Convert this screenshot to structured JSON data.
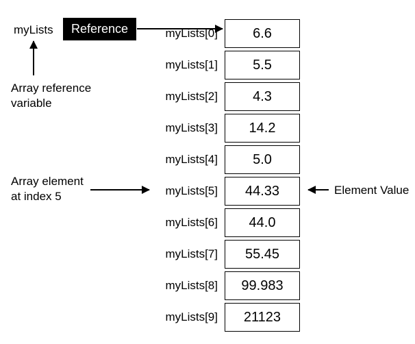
{
  "variable_name": "myLists",
  "reference_label": "Reference",
  "captions": {
    "array_ref_var": "Array reference\nvariable",
    "array_elem_at": "Array element\nat index 5",
    "element_value": "Element Value"
  },
  "rows": [
    {
      "label": "myLists[0]",
      "value": "6.6"
    },
    {
      "label": "myLists[1]",
      "value": "5.5"
    },
    {
      "label": "myLists[2]",
      "value": "4.3"
    },
    {
      "label": "myLists[3]",
      "value": "14.2"
    },
    {
      "label": "myLists[4]",
      "value": "5.0"
    },
    {
      "label": "myLists[5]",
      "value": "44.33"
    },
    {
      "label": "myLists[6]",
      "value": "44.0"
    },
    {
      "label": "myLists[7]",
      "value": "55.45"
    },
    {
      "label": "myLists[8]",
      "value": "99.983"
    },
    {
      "label": "myLists[9]",
      "value": "21123"
    }
  ],
  "chart_data": {
    "type": "table",
    "title": "Array reference diagram",
    "categories": [
      "myLists[0]",
      "myLists[1]",
      "myLists[2]",
      "myLists[3]",
      "myLists[4]",
      "myLists[5]",
      "myLists[6]",
      "myLists[7]",
      "myLists[8]",
      "myLists[9]"
    ],
    "values": [
      6.6,
      5.5,
      4.3,
      14.2,
      5.0,
      44.33,
      44.0,
      55.45,
      99.983,
      21123
    ]
  }
}
